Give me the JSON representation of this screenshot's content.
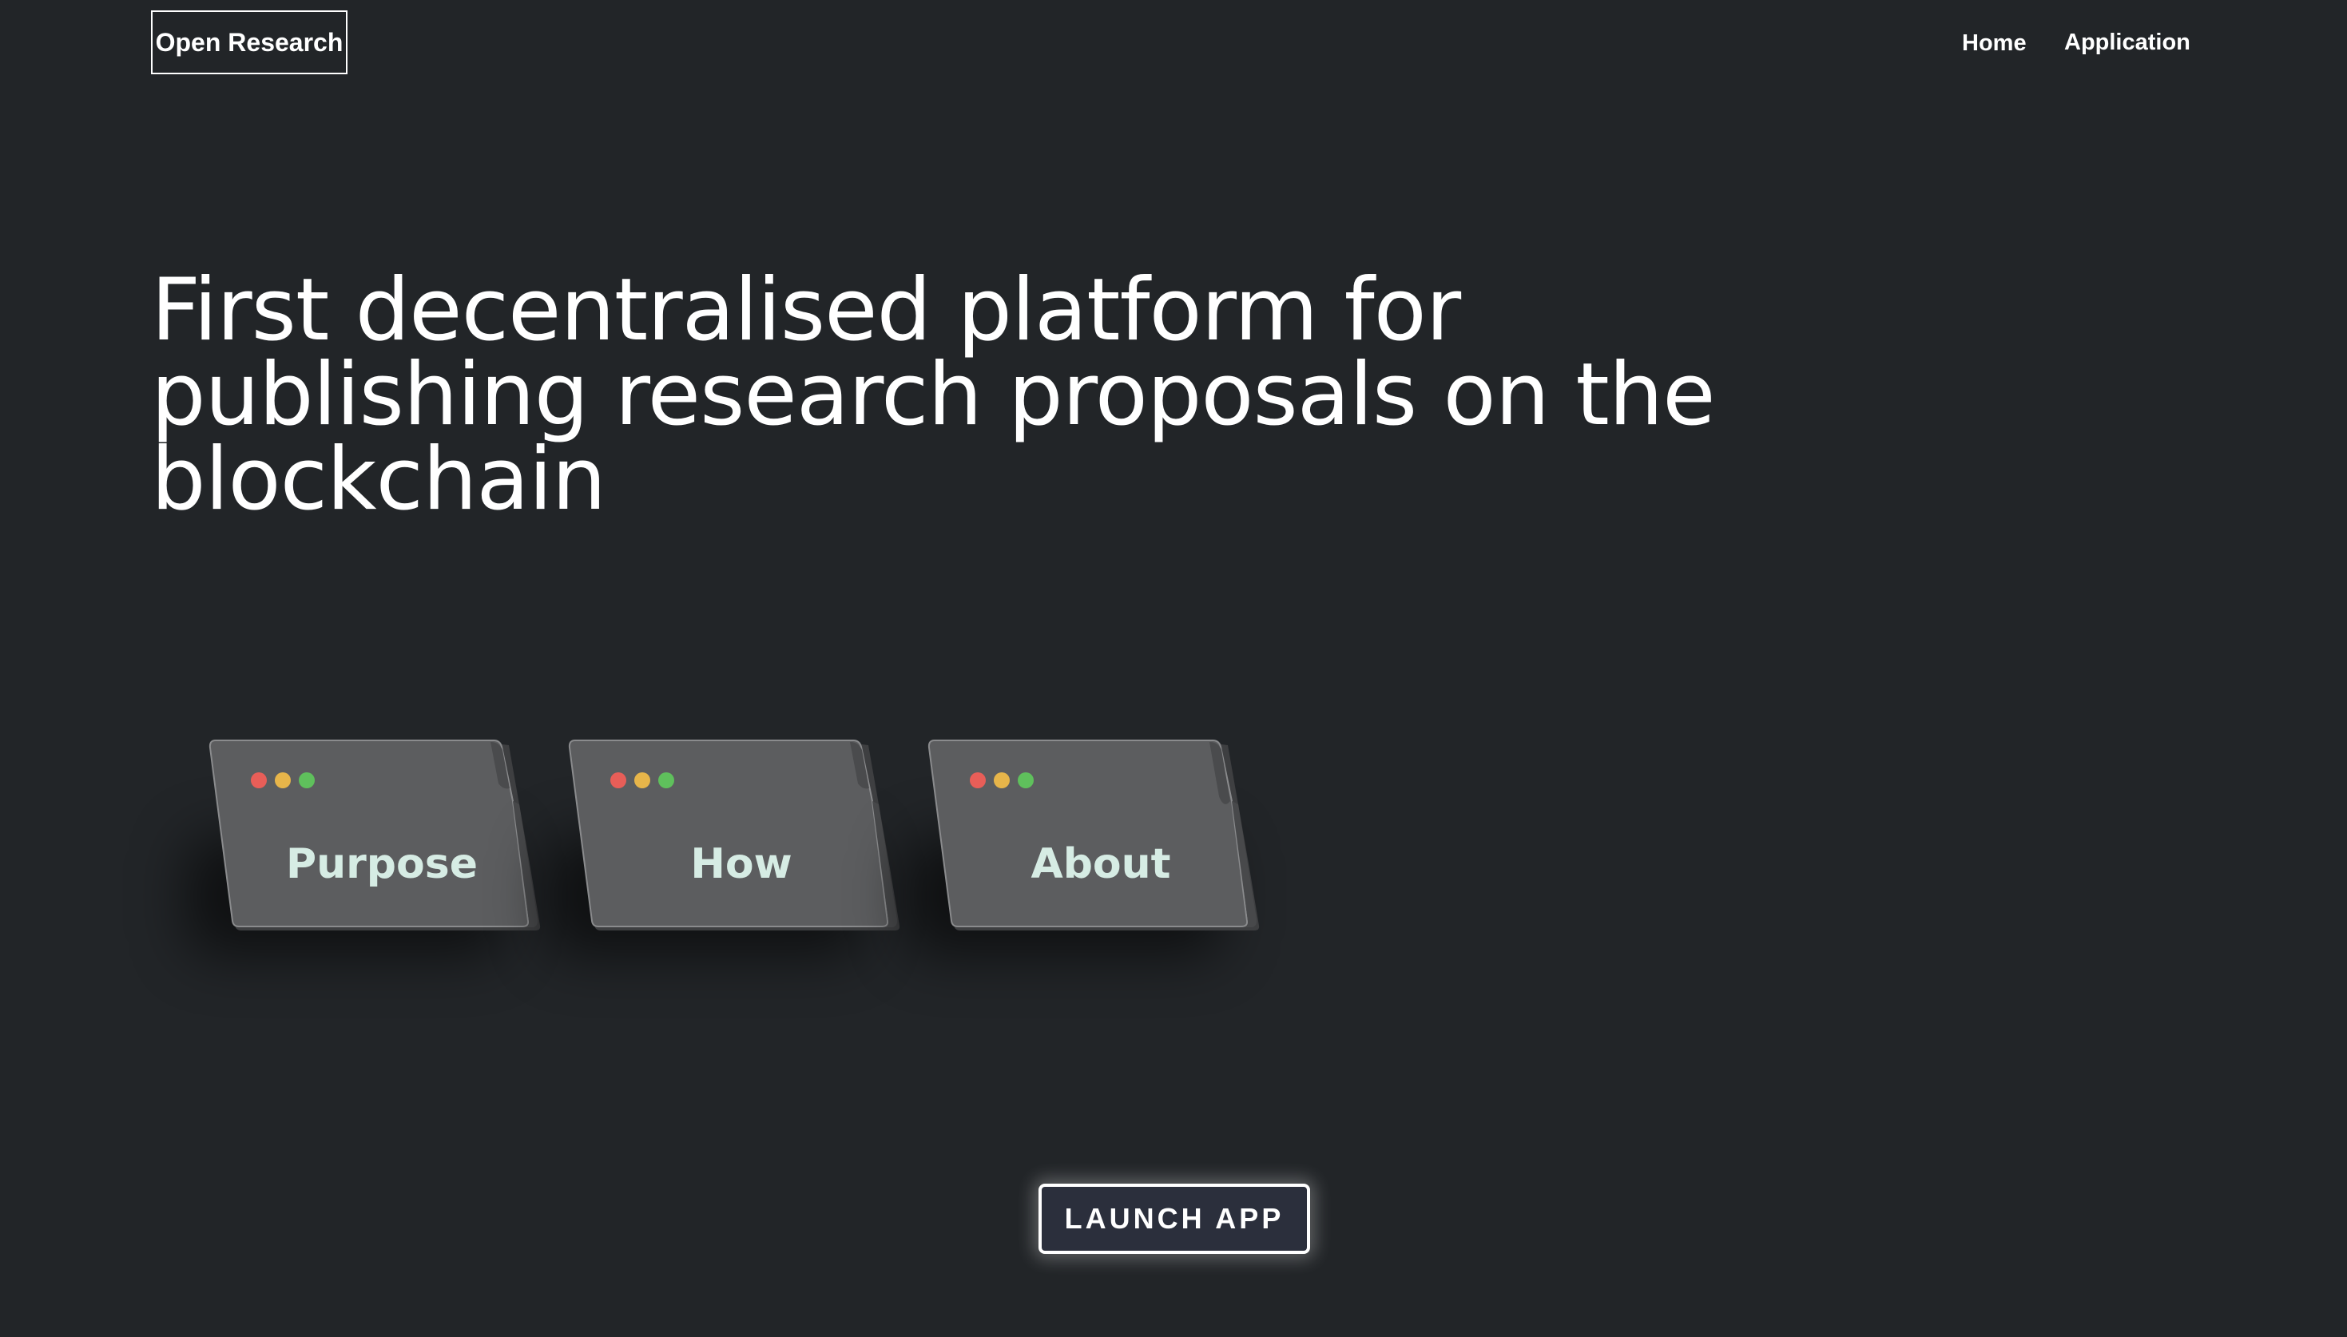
{
  "header": {
    "logo_text": "Open Research",
    "nav": [
      {
        "label": "Home"
      },
      {
        "label": "Application"
      }
    ]
  },
  "hero": {
    "heading": "First decentralised platform for publishing research proposals on the blockchain"
  },
  "cards": [
    {
      "label": "Purpose",
      "dots": [
        "red-dot",
        "yellow-dot",
        "green-dot"
      ]
    },
    {
      "label": "How",
      "dots": [
        "red-dot",
        "yellow-dot",
        "green-dot"
      ]
    },
    {
      "label": "About",
      "dots": [
        "red-dot",
        "yellow-dot",
        "green-dot"
      ]
    }
  ],
  "cta": {
    "label": "LAUNCH APP"
  },
  "colors": {
    "background": "#222528",
    "card_face": "#5c5d5f",
    "card_edge": "#3e3f41",
    "card_text": "#d6ece4",
    "dot_red": "#e85e58",
    "dot_yellow": "#e7b54a",
    "dot_green": "#5fc05c",
    "button_bg": "#2b2f3c"
  }
}
